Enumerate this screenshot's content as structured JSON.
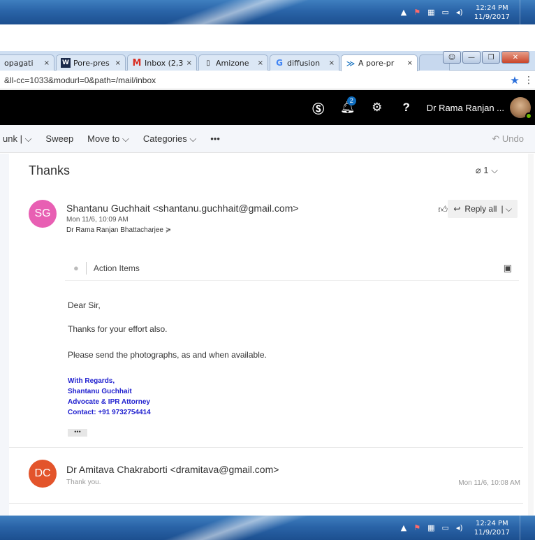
{
  "taskbar": {
    "time": "12:24 PM",
    "date": "11/9/2017"
  },
  "browser": {
    "tabs": [
      {
        "label": "opagati",
        "icon": "plain"
      },
      {
        "label": "Pore-pres",
        "icon": "w-icon"
      },
      {
        "label": "Inbox (2,3",
        "icon": "gmail-icon"
      },
      {
        "label": "Amizone",
        "icon": "page-icon"
      },
      {
        "label": "diffusion",
        "icon": "google-icon"
      },
      {
        "label": "A pore-pr",
        "icon": "outlook-icon"
      }
    ],
    "close_glyph": "×",
    "url": "&ll-cc=1033&modurl=0&path=/mail/inbox"
  },
  "outlook_header": {
    "notification_count": "2",
    "help_label": "?",
    "user_name": "Dr Rama Ranjan ..."
  },
  "command_bar": {
    "junk": "unk |",
    "sweep": "Sweep",
    "move_to": "Move to",
    "categories": "Categories",
    "more": "•••",
    "undo": "Undo"
  },
  "thread": {
    "subject": "Thanks",
    "attachment_count": "1",
    "message1": {
      "initials": "SG",
      "avatar_color": "#e85fb3",
      "sender": "Shantanu Guchhait <shantanu.guchhait@gmail.com>",
      "date": "Mon 11/6, 10:09 AM",
      "recipients": "Dr Rama Ranjan Bhattacharjee",
      "reply_all": "Reply all",
      "action_items": "Action Items",
      "greeting": "Dear Sir,",
      "line1": "Thanks for your effort also.",
      "line2": "Please send the photographs, as and when available.",
      "signature": [
        "With Regards,",
        "Shantanu Guchhait",
        "Advocate & IPR Attorney",
        "Contact: +91 9732754414"
      ],
      "more_glyph": "•••"
    },
    "message2": {
      "initials": "DC",
      "avatar_color": "#e3542b",
      "sender": "Dr Amitava Chakraborti <dramitava@gmail.com>",
      "snippet": "Thank you.",
      "date": "Mon 11/6, 10:08 AM"
    }
  }
}
